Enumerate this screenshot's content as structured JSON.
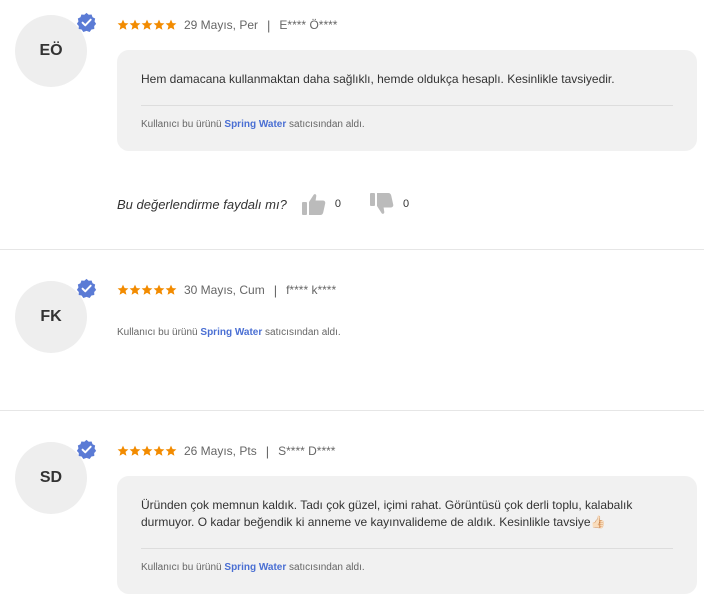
{
  "reviews": [
    {
      "initials": "EÖ",
      "rating": 5,
      "date": "29 Mayıs, Per",
      "separator": "|",
      "user": "E**** Ö****",
      "text": "Hem damacana kullanmaktan daha sağlıklı, hemde oldukça hesaplı. Kesinlikle tavsiyedir.",
      "seller_prefix": "Kullanıcı bu ürünü",
      "seller_name": "Spring Water",
      "seller_suffix": "satıcısından aldı.",
      "helpful_question": "Bu değerlendirme faydalı mı?",
      "likes": "0",
      "dislikes": "0"
    },
    {
      "initials": "FK",
      "rating": 5,
      "date": "30 Mayıs, Cum",
      "separator": "|",
      "user": "f**** k****",
      "seller_prefix": "Kullanıcı bu ürünü",
      "seller_name": "Spring Water",
      "seller_suffix": "satıcısından aldı."
    },
    {
      "initials": "SD",
      "rating": 5,
      "date": "26 Mayıs, Pts",
      "separator": "|",
      "user": "S**** D****",
      "text": "Üründen çok memnun kaldık. Tadı çok güzel, içimi rahat. Görüntüsü çok derli toplu, kalabalık durmuyor. O kadar beğendik ki anneme ve kayınvalideme de aldık. Kesinlikle tavsiye👍🏻",
      "seller_prefix": "Kullanıcı bu ürünü",
      "seller_name": "Spring Water",
      "seller_suffix": "satıcısından aldı."
    }
  ],
  "colors": {
    "star": "#f28b00",
    "verified": "#5b7bd5",
    "store_link": "#4a6fd3",
    "bubble": "#f1f1f1",
    "thumb": "#bbbbbb"
  },
  "icons": {
    "rating": "star-icon",
    "verified": "verified-badge-icon",
    "like": "thumbs-up-icon",
    "dislike": "thumbs-down-icon"
  }
}
